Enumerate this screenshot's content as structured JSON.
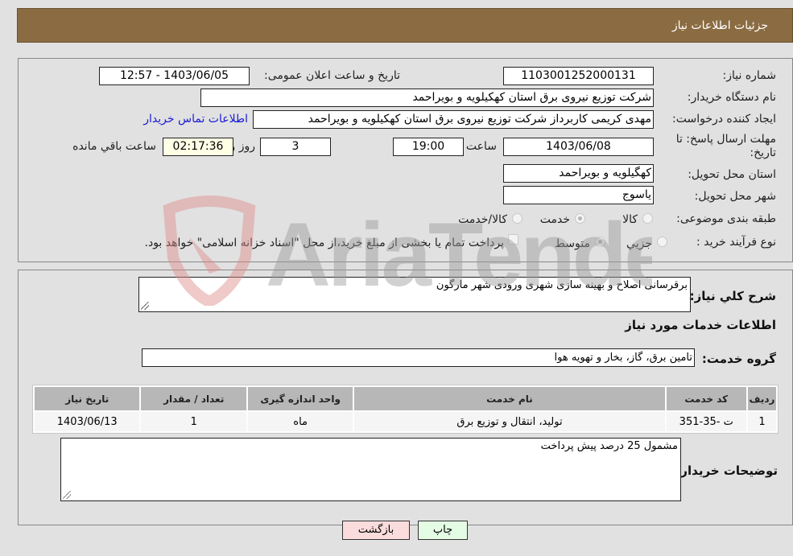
{
  "header": {
    "title": "جزئیات اطلاعات نیاز"
  },
  "form": {
    "need_number": {
      "label": "شماره نیاز:",
      "value": "1103001252000131"
    },
    "announce_datetime": {
      "label": "تاریخ و ساعت اعلان عمومی:",
      "value": "1403/06/05 - 12:57"
    },
    "buyer_org": {
      "label": "نام دستگاه خریدار:",
      "value": "شرکت توزیع نیروی برق استان کهکیلویه و بویراحمد"
    },
    "requester": {
      "label": "ایجاد کننده درخواست:",
      "value": "مهدی کریمی کاربرداز شرکت توزیع نیروی برق استان کهکیلویه و بویراحمد",
      "contact_link": "اطلاعات تماس خریدار"
    },
    "deadline": {
      "label": "مهلت ارسال پاسخ: تا تاریخ:",
      "date": "1403/06/08",
      "time_label": "ساعت",
      "time": "19:00",
      "days": "3",
      "days_label": "روز و",
      "remaining": "02:17:36",
      "remaining_label": "ساعت باقي مانده"
    },
    "province": {
      "label": "استان محل تحویل:",
      "value": "کهگیلویه و بویراحمد"
    },
    "city": {
      "label": "شهر محل تحویل:",
      "value": "یاسوج"
    },
    "category": {
      "label": "طبقه بندی موضوعی:",
      "options": [
        "کالا",
        "خدمت",
        "کالا/خدمت"
      ],
      "selected": "خدمت"
    },
    "purchase_type": {
      "label": "نوع فرآیند خرید :",
      "options": [
        "جزيي",
        "متوسط"
      ],
      "selected": "متوسط",
      "treasury_note": "پرداخت تمام یا بخشی از مبلغ خرید،از محل \"اسناد خزانه اسلامی\" خواهد بود.",
      "treasury_checked": false
    }
  },
  "details": {
    "description_label": "شرح کلي نیاز:",
    "description": "برقرسانی اصلاح و بهینه سازی شهری ورودی شهر مارگون",
    "services_heading": "اطلاعات خدمات مورد نیاز",
    "service_group_label": "گروه خدمت:",
    "service_group": "تامین برق، گاز، بخار و تهویه هوا",
    "table": {
      "headers": [
        "ردیف",
        "کد خدمت",
        "نام خدمت",
        "واحد اندازه گیری",
        "تعداد / مقدار",
        "تاریخ نیاز"
      ],
      "rows": [
        [
          "1",
          "ت -35-351",
          "تولید، انتقال و توزیع برق",
          "ماه",
          "1",
          "1403/06/13"
        ]
      ]
    },
    "buyer_notes_label": "توضیحات خریدار:",
    "buyer_notes": "مشمول 25 درصد پیش پرداخت"
  },
  "buttons": {
    "print": "چاپ",
    "back": "بازگشت"
  },
  "watermark": {
    "text": "AriaTender.neT"
  },
  "colors": {
    "header_bg": "#8b6c42",
    "link": "#1a1ad6",
    "print_bg": "#e4fbe4",
    "back_bg": "#fbdcdc"
  }
}
